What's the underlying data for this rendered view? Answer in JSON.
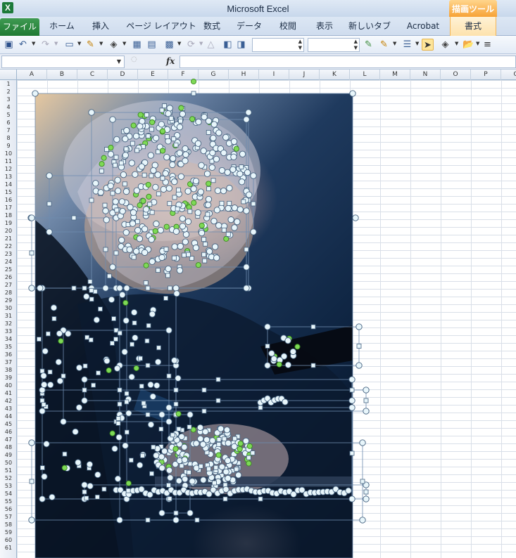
{
  "window": {
    "title": "Microsoft Excel",
    "context_tab_group": "描画ツール"
  },
  "ribbon": {
    "tabs": [
      {
        "label": "ファイル"
      },
      {
        "label": "ホーム"
      },
      {
        "label": "挿入"
      },
      {
        "label": "ページ レイアウト"
      },
      {
        "label": "数式"
      },
      {
        "label": "データ"
      },
      {
        "label": "校閲"
      },
      {
        "label": "表示"
      },
      {
        "label": "新しいタブ"
      },
      {
        "label": "Acrobat"
      },
      {
        "label": "書式"
      }
    ]
  },
  "formula_bar": {
    "name_box": "",
    "fx_label": "fx",
    "formula": ""
  },
  "grid": {
    "columns": [
      "A",
      "B",
      "C",
      "D",
      "E",
      "F",
      "G",
      "H",
      "I",
      "J",
      "K",
      "L",
      "M",
      "N",
      "O",
      "P",
      "Q"
    ],
    "rows": [
      "1",
      "2",
      "3",
      "4",
      "5",
      "6",
      "7",
      "8",
      "9",
      "10",
      "11",
      "12",
      "13",
      "14",
      "15",
      "16",
      "17",
      "18",
      "19",
      "20",
      "21",
      "22",
      "23",
      "24",
      "25",
      "26",
      "27",
      "28",
      "29",
      "30",
      "31",
      "32",
      "33",
      "34",
      "35",
      "36",
      "37",
      "38",
      "39",
      "40",
      "41",
      "42",
      "43",
      "44",
      "45",
      "46",
      "47",
      "48",
      "49",
      "50",
      "51",
      "52",
      "53",
      "54",
      "55",
      "56",
      "57",
      "58",
      "59",
      "60",
      "61"
    ]
  },
  "colors": {
    "file_tab": "#1f7a33",
    "context_tab": "#f7a236",
    "handle_fill": "#e8f6fb",
    "rotate_handle": "#7ed957"
  }
}
